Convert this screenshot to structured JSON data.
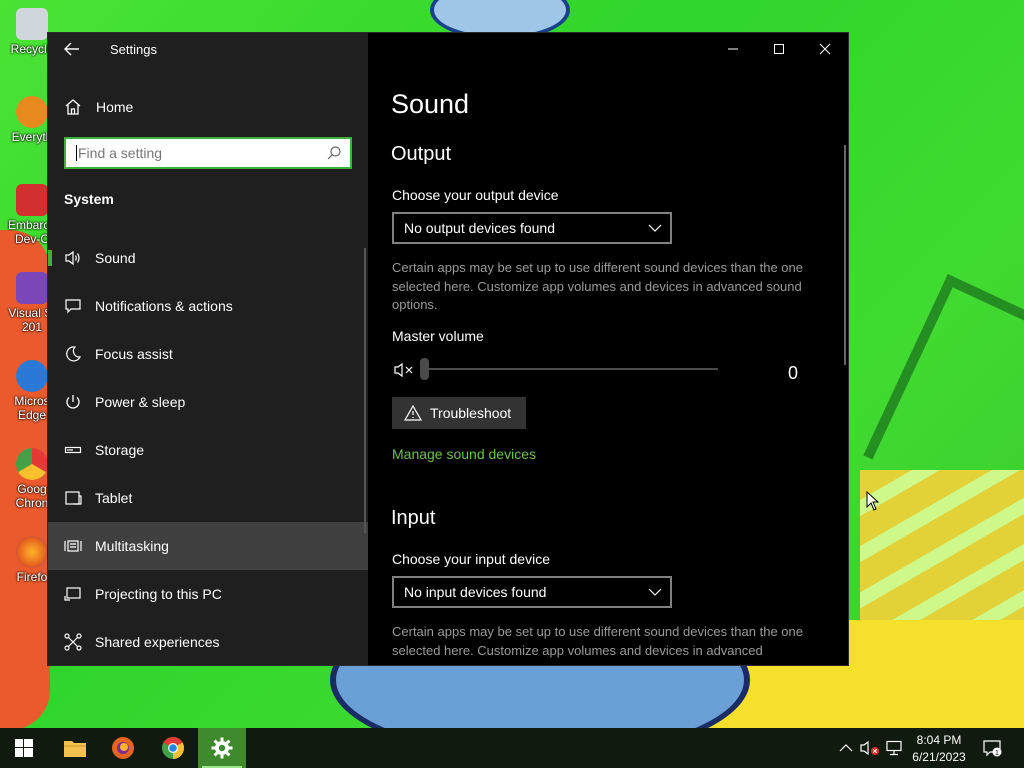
{
  "desktop": {
    "icons": [
      {
        "label": "Recycle",
        "color": "#d0d7dc"
      },
      {
        "label": "Everyth",
        "color": "#e88a1d"
      },
      {
        "label": "Embarca Dev-C",
        "color": "#d22f2f"
      },
      {
        "label": "Visual St 201",
        "color": "#7a47b8"
      },
      {
        "label": "Micros Edge",
        "color": "#2b79d6"
      },
      {
        "label": "Goog Chron",
        "color": "#e9b42b"
      },
      {
        "label": "Firefo",
        "color": "#e8641d"
      }
    ]
  },
  "window": {
    "title": "Settings",
    "accent": "#3ab33a"
  },
  "sidebar": {
    "home_label": "Home",
    "search_placeholder": "Find a setting",
    "section_label": "System",
    "items": [
      {
        "label": "Sound",
        "icon": "speaker-icon"
      },
      {
        "label": "Notifications & actions",
        "icon": "notification-icon"
      },
      {
        "label": "Focus assist",
        "icon": "moon-icon"
      },
      {
        "label": "Power & sleep",
        "icon": "power-icon"
      },
      {
        "label": "Storage",
        "icon": "storage-icon"
      },
      {
        "label": "Tablet",
        "icon": "tablet-icon"
      },
      {
        "label": "Multitasking",
        "icon": "multitasking-icon"
      },
      {
        "label": "Projecting to this PC",
        "icon": "projecting-icon"
      },
      {
        "label": "Shared experiences",
        "icon": "shared-experiences-icon"
      }
    ],
    "active_index": 0,
    "hover_index": 6
  },
  "content": {
    "page_title": "Sound",
    "output": {
      "heading": "Output",
      "device_label": "Choose your output device",
      "device_value": "No output devices found",
      "description": "Certain apps may be set up to use different sound devices than the one selected here. Customize app volumes and devices in advanced sound options.",
      "master_volume_label": "Master volume",
      "volume_value": "0",
      "troubleshoot_label": "Troubleshoot",
      "manage_link": "Manage sound devices"
    },
    "input": {
      "heading": "Input",
      "device_label": "Choose your input device",
      "device_value": "No input devices found",
      "description": "Certain apps may be set up to use different sound devices than the one selected here. Customize app volumes and devices in advanced"
    }
  },
  "taskbar": {
    "apps": [
      {
        "name": "start",
        "icon": "windows-start-icon"
      },
      {
        "name": "file-explorer",
        "icon": "folder-icon"
      },
      {
        "name": "firefox",
        "icon": "firefox-icon"
      },
      {
        "name": "chrome",
        "icon": "chrome-icon"
      },
      {
        "name": "settings",
        "icon": "gear-icon"
      }
    ],
    "time": "8:04 PM",
    "date": "6/21/2023",
    "notification_count": "1"
  }
}
